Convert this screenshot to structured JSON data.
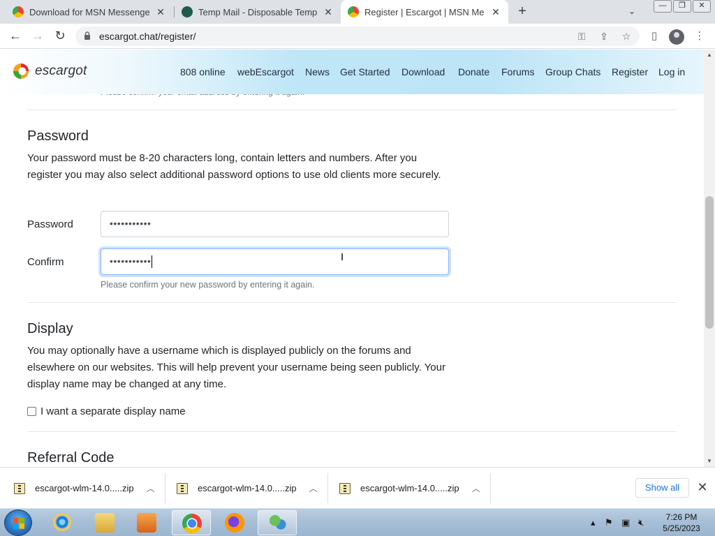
{
  "browser": {
    "tabs": [
      {
        "title": "Download for MSN Messenger | E",
        "favicon": "chrome-icon",
        "active": false
      },
      {
        "title": "Temp Mail - Disposable Tempora",
        "favicon": "tempmail-icon",
        "active": false
      },
      {
        "title": "Register | Escargot | MSN Messe",
        "favicon": "chrome-icon",
        "active": true
      }
    ],
    "new_tab_symbol": "+",
    "url": "escargot.chat/register/"
  },
  "site": {
    "logo_text": "escargot",
    "nav": [
      "808 online",
      "webEscargot",
      "News",
      "Get Started",
      "Download",
      "Donate",
      "Forums",
      "Group Chats",
      "Register",
      "Log in"
    ],
    "colors": {
      "header_gradient": "#bfe6f7",
      "focus_ring": "#86b7fe"
    }
  },
  "form": {
    "prev_hint": "Please confirm your email address by entering it again.",
    "password_section": {
      "title": "Password",
      "description": "Your password must be 8-20 characters long, contain letters and numbers. After you register you may also select additional password options to use old clients more securely.",
      "password_label": "Password",
      "password_value": "•••••••••••",
      "confirm_label": "Confirm",
      "confirm_value": "•••••••••••",
      "confirm_help": "Please confirm your new password by entering it again."
    },
    "display_section": {
      "title": "Display",
      "description": "You may optionally have a username which is displayed publicly on the forums and elsewhere on our websites. This will help prevent your username being seen publicly. Your display name may be changed at any time.",
      "checkbox_label": "I want a separate display name",
      "checked": false
    },
    "referral_section": {
      "title": "Referral Code"
    }
  },
  "downloads": {
    "items": [
      "escargot-wlm-14.0.....zip",
      "escargot-wlm-14.0.....zip",
      "escargot-wlm-14.0.....zip"
    ],
    "show_all": "Show all"
  },
  "taskbar": {
    "apps": [
      "internet-explorer-icon",
      "file-explorer-icon",
      "media-player-icon",
      "chrome-icon",
      "firefox-icon",
      "escargot-messenger-icon"
    ],
    "time": "7:26 PM",
    "date": "5/25/2023"
  }
}
